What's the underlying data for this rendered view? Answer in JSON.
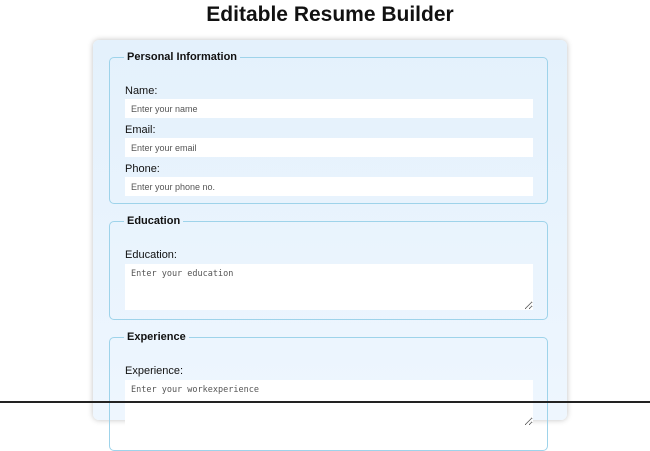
{
  "page": {
    "title": "Editable Resume Builder"
  },
  "personal_info": {
    "legend": "Personal Information",
    "name_label": "Name:",
    "name_placeholder": "Enter your name",
    "email_label": "Email:",
    "email_placeholder": "Enter your email",
    "phone_label": "Phone:",
    "phone_placeholder": "Enter your phone no."
  },
  "education": {
    "legend": "Education",
    "label": "Education:",
    "placeholder": "Enter your education"
  },
  "experience": {
    "legend": "Experience",
    "label": "Experience:",
    "placeholder": "Enter your workexperience"
  },
  "colors": {
    "card_background": "#e9f4fd",
    "section_border": "#9ed3ea",
    "input_background": "#ffffff"
  }
}
